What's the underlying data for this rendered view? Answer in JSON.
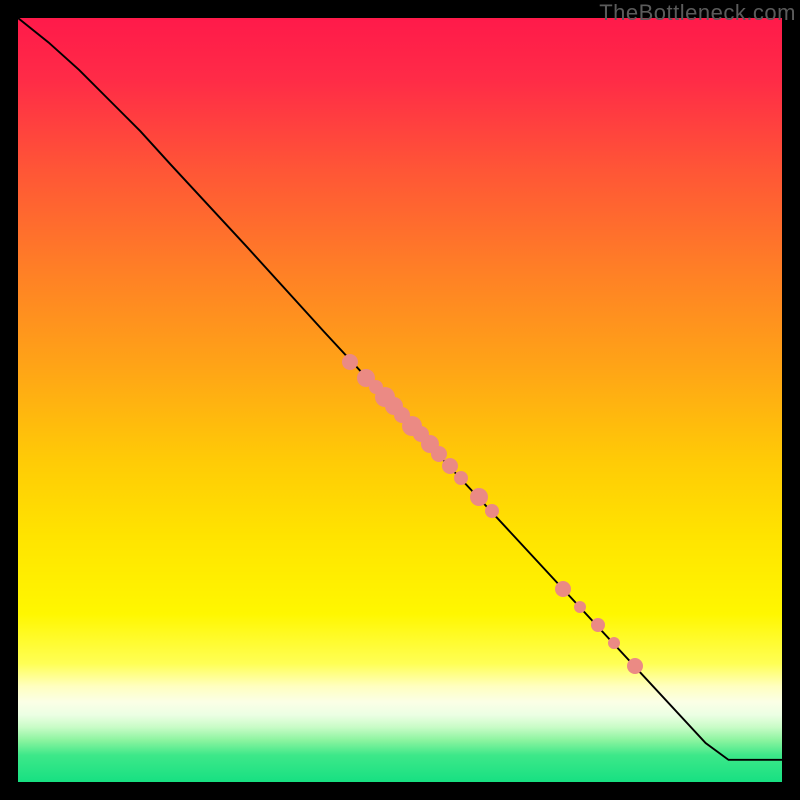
{
  "watermark": "TheBottleneck.com",
  "colors": {
    "dot_fill": "#eb8a84",
    "curve_stroke": "#000000",
    "frame": "#000000"
  },
  "gradient_stops": [
    {
      "offset": 0.0,
      "color": "#ff1a4a"
    },
    {
      "offset": 0.08,
      "color": "#ff2b47"
    },
    {
      "offset": 0.2,
      "color": "#ff5636"
    },
    {
      "offset": 0.33,
      "color": "#ff7f26"
    },
    {
      "offset": 0.46,
      "color": "#ffa516"
    },
    {
      "offset": 0.58,
      "color": "#ffcb06"
    },
    {
      "offset": 0.68,
      "color": "#ffe400"
    },
    {
      "offset": 0.78,
      "color": "#fff700"
    },
    {
      "offset": 0.845,
      "color": "#ffff55"
    },
    {
      "offset": 0.875,
      "color": "#ffffc0"
    },
    {
      "offset": 0.895,
      "color": "#fbffe6"
    },
    {
      "offset": 0.912,
      "color": "#ecffe4"
    },
    {
      "offset": 0.928,
      "color": "#c9fcc7"
    },
    {
      "offset": 0.945,
      "color": "#8df4a0"
    },
    {
      "offset": 0.965,
      "color": "#3de889"
    },
    {
      "offset": 1.0,
      "color": "#17e082"
    }
  ],
  "chart_data": {
    "type": "line",
    "title": "",
    "xlabel": "",
    "ylabel": "",
    "xlim": [
      0,
      100
    ],
    "ylim": [
      0,
      100
    ],
    "series": [
      {
        "name": "curve",
        "points": [
          {
            "x": 0.0,
            "y": 100.0
          },
          {
            "x": 4.0,
            "y": 96.8
          },
          {
            "x": 8.0,
            "y": 93.2
          },
          {
            "x": 12.0,
            "y": 89.2
          },
          {
            "x": 16.0,
            "y": 85.2
          },
          {
            "x": 20.0,
            "y": 80.8
          },
          {
            "x": 30.0,
            "y": 70.0
          },
          {
            "x": 40.0,
            "y": 59.0
          },
          {
            "x": 50.0,
            "y": 48.2
          },
          {
            "x": 60.0,
            "y": 37.5
          },
          {
            "x": 70.0,
            "y": 26.7
          },
          {
            "x": 80.0,
            "y": 15.9
          },
          {
            "x": 90.0,
            "y": 5.1
          },
          {
            "x": 93.0,
            "y": 2.9
          },
          {
            "x": 95.0,
            "y": 2.9
          },
          {
            "x": 100.0,
            "y": 2.9
          }
        ]
      }
    ],
    "scatter": [
      {
        "x": 43.5,
        "y": 55.0,
        "r": 8
      },
      {
        "x": 45.6,
        "y": 52.9,
        "r": 9
      },
      {
        "x": 46.8,
        "y": 51.7,
        "r": 7
      },
      {
        "x": 48.0,
        "y": 50.4,
        "r": 10
      },
      {
        "x": 49.2,
        "y": 49.2,
        "r": 9
      },
      {
        "x": 50.3,
        "y": 48.0,
        "r": 8
      },
      {
        "x": 51.6,
        "y": 46.6,
        "r": 10
      },
      {
        "x": 52.7,
        "y": 45.5,
        "r": 8
      },
      {
        "x": 53.9,
        "y": 44.2,
        "r": 9
      },
      {
        "x": 55.1,
        "y": 42.9,
        "r": 8
      },
      {
        "x": 56.5,
        "y": 41.4,
        "r": 8
      },
      {
        "x": 58.0,
        "y": 39.8,
        "r": 7
      },
      {
        "x": 60.3,
        "y": 37.3,
        "r": 9
      },
      {
        "x": 62.0,
        "y": 35.5,
        "r": 7
      },
      {
        "x": 71.3,
        "y": 25.3,
        "r": 8
      },
      {
        "x": 73.6,
        "y": 22.9,
        "r": 6
      },
      {
        "x": 75.9,
        "y": 20.5,
        "r": 7
      },
      {
        "x": 78.0,
        "y": 18.2,
        "r": 6
      },
      {
        "x": 80.8,
        "y": 15.2,
        "r": 8
      }
    ]
  }
}
